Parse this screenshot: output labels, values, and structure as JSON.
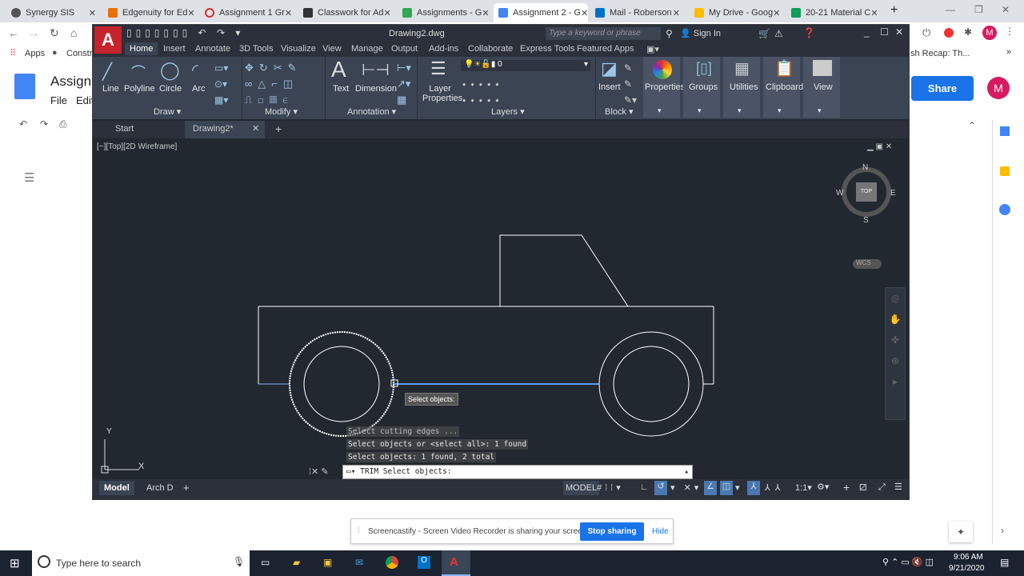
{
  "browser": {
    "tabs": [
      {
        "label": "Synergy SIS",
        "color": "#555"
      },
      {
        "label": "Edgenuity for Ed",
        "color": "#e8710a"
      },
      {
        "label": "Assignment 1 Gr",
        "color": "#d93025"
      },
      {
        "label": "Classwork for Ad",
        "color": "#333"
      },
      {
        "label": "Assignments - G",
        "color": "#34a853"
      },
      {
        "label": "Assignment 2 - G",
        "color": "#4285f4"
      },
      {
        "label": "Mail - Roberson",
        "color": "#0072c6"
      },
      {
        "label": "My Drive - Goog",
        "color": "#fbbc04"
      },
      {
        "label": "20-21 Material C",
        "color": "#0f9d58"
      }
    ],
    "bookmarks": {
      "apps": "Apps",
      "constr": "Constru",
      "right": "sh Recap: Th..."
    },
    "avatar": "M"
  },
  "docs": {
    "title": "Assignm",
    "menu_file": "File",
    "menu_edit": "Edit",
    "share": "Share",
    "avatar": "M"
  },
  "autocad": {
    "title": "Drawing2.dwg",
    "search_placeholder": "Type a keyword or phrase",
    "sign_in": "Sign In",
    "ribbon_tabs": [
      "Home",
      "Insert",
      "Annotate",
      "3D Tools",
      "Visualize",
      "View",
      "Manage",
      "Output",
      "Add-ins",
      "Collaborate",
      "Express Tools",
      "Featured Apps"
    ],
    "draw_tools": [
      "Line",
      "Polyline",
      "Circle",
      "Arc"
    ],
    "annotation_tools": [
      "Text",
      "Dimension"
    ],
    "layer_props": "Layer Properties",
    "layer_value": "0",
    "insert": "Insert",
    "big_buttons": [
      "Properties",
      "Groups",
      "Utilities",
      "Clipboard",
      "View"
    ],
    "panels": [
      "Draw",
      "Modify",
      "Annotation",
      "Layers",
      "Block"
    ],
    "doc_tabs": [
      "Start",
      "Drawing2*"
    ],
    "viewport_label": "[−][Top][2D Wireframe]",
    "viewcube": {
      "n": "N",
      "s": "S",
      "e": "E",
      "w": "W",
      "top": "TOP",
      "wcs": "WCS"
    },
    "ucs": {
      "x": "X",
      "y": "Y"
    },
    "tooltip": "Select objects:",
    "command_history": [
      "Select cutting edges ...",
      "Select objects or <select all>: 1 found",
      "Select objects: 1 found, 2 total"
    ],
    "command_line": "TRIM Select objects:",
    "layout_tabs": [
      "Model",
      "Arch D"
    ],
    "status": {
      "model": "MODEL",
      "scale": "1:1"
    }
  },
  "screencastify": {
    "message": "Screencastify - Screen Video Recorder is sharing your screen.",
    "stop": "Stop sharing",
    "hide": "Hide"
  },
  "taskbar": {
    "search": "Type here to search",
    "time": "9:06 AM",
    "date": "9/21/2020"
  }
}
